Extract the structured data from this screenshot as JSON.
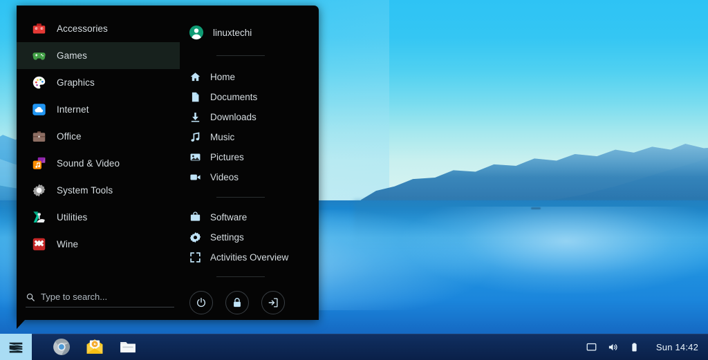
{
  "desktop": {
    "wallpaper_name": "lake-mountains-blue",
    "sky_color": "#33c4f5",
    "water_color": "#2a9ade"
  },
  "menu": {
    "categories": [
      {
        "label": "Accessories",
        "icon": "toolbox-icon",
        "selected": false
      },
      {
        "label": "Games",
        "icon": "gamepad-icon",
        "selected": true
      },
      {
        "label": "Graphics",
        "icon": "palette-icon",
        "selected": false
      },
      {
        "label": "Internet",
        "icon": "cloud-icon",
        "selected": false
      },
      {
        "label": "Office",
        "icon": "briefcase-icon",
        "selected": false
      },
      {
        "label": "Sound & Video",
        "icon": "music-video-icon",
        "selected": false
      },
      {
        "label": "System Tools",
        "icon": "gear-icon",
        "selected": false
      },
      {
        "label": "Utilities",
        "icon": "utilities-icon",
        "selected": false
      },
      {
        "label": "Wine",
        "icon": "wine-icon",
        "selected": false
      }
    ],
    "search": {
      "placeholder": "Type to search...",
      "value": "",
      "icon": "search-icon"
    },
    "user": {
      "name": "linuxtechi",
      "avatar_icon": "user-avatar-icon",
      "avatar_color": "#0f9b74"
    },
    "places": [
      {
        "label": "Home",
        "icon": "home-icon"
      },
      {
        "label": "Documents",
        "icon": "document-icon"
      },
      {
        "label": "Downloads",
        "icon": "download-icon"
      },
      {
        "label": "Music",
        "icon": "music-note-icon"
      },
      {
        "label": "Pictures",
        "icon": "picture-icon"
      },
      {
        "label": "Videos",
        "icon": "video-camera-icon"
      }
    ],
    "system": [
      {
        "label": "Software",
        "icon": "software-bag-icon"
      },
      {
        "label": "Settings",
        "icon": "settings-gear-icon"
      },
      {
        "label": "Activities Overview",
        "icon": "activities-overview-icon"
      }
    ],
    "power_buttons": [
      {
        "name": "shutdown",
        "icon": "power-icon"
      },
      {
        "name": "lock",
        "icon": "lock-icon"
      },
      {
        "name": "logout",
        "icon": "logout-icon"
      }
    ],
    "accent_color": "#17211d"
  },
  "taskbar": {
    "start_button": {
      "label": "Zorin menu",
      "icon": "zorin-logo-icon"
    },
    "apps": [
      {
        "name": "Chromium",
        "icon": "chromium-icon"
      },
      {
        "name": "Mail",
        "icon": "mail-icon"
      },
      {
        "name": "Files",
        "icon": "file-manager-icon"
      }
    ],
    "tray": [
      {
        "name": "display",
        "icon": "display-icon"
      },
      {
        "name": "volume",
        "icon": "volume-icon"
      },
      {
        "name": "battery",
        "icon": "battery-icon"
      }
    ],
    "clock": "Sun 14:42",
    "background_color": "#0e2a59",
    "start_highlight_color": "#a9dcf4"
  }
}
